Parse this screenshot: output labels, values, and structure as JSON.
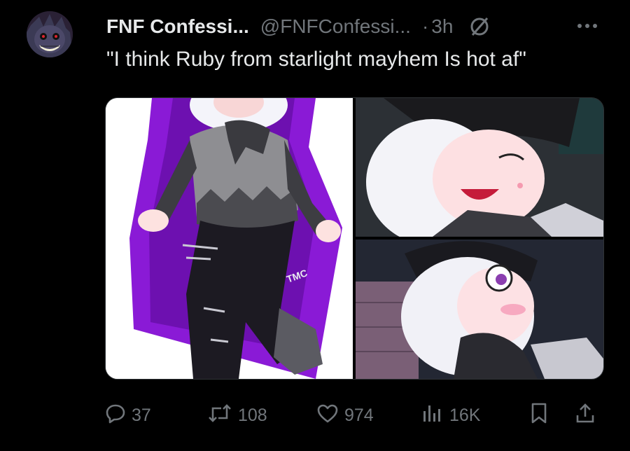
{
  "tweet": {
    "author_name": "FNF Confessi...",
    "handle": "@FNFConfessi...",
    "separator": "·",
    "time": "3h",
    "text": "\"I think Ruby from starlight mayhem Is hot af\""
  },
  "media": {
    "watermark": "TMC"
  },
  "actions": {
    "replies": "37",
    "retweets": "108",
    "likes": "974",
    "views": "16K"
  },
  "icons": {
    "badge": "slashed-circle-icon",
    "more": "more-icon",
    "reply": "reply-icon",
    "retweet": "retweet-icon",
    "like": "heart-icon",
    "views": "views-icon",
    "bookmark": "bookmark-icon",
    "share": "share-icon"
  },
  "colors": {
    "background": "#000000",
    "text_primary": "#e7e9ea",
    "text_secondary": "#71767b",
    "art_purple": "#8a1ad6"
  }
}
